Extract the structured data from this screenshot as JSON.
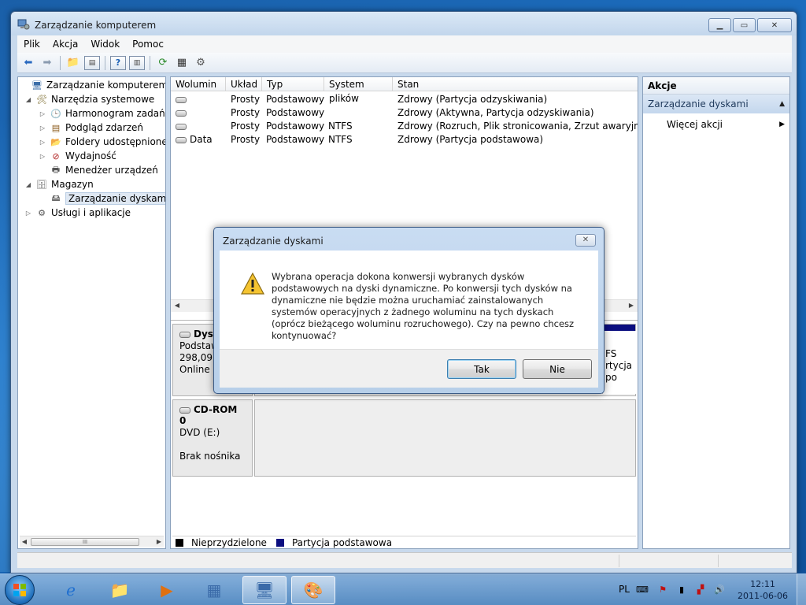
{
  "window": {
    "title": "Zarządzanie komputerem"
  },
  "menu": [
    "Plik",
    "Akcja",
    "Widok",
    "Pomoc"
  ],
  "tree": {
    "items": [
      {
        "label": "Zarządzanie komputerem (loka",
        "icon": "computer-icon",
        "level": 0,
        "expander": ""
      },
      {
        "label": "Narzędzia systemowe",
        "icon": "tools-icon",
        "level": 1,
        "expander": "◢"
      },
      {
        "label": "Harmonogram zadań",
        "icon": "clock-icon",
        "level": 2,
        "expander": "▷"
      },
      {
        "label": "Podgląd zdarzeń",
        "icon": "event-viewer-icon",
        "level": 2,
        "expander": "▷"
      },
      {
        "label": "Foldery udostępnione",
        "icon": "shared-folder-icon",
        "level": 2,
        "expander": "▷"
      },
      {
        "label": "Wydajność",
        "icon": "performance-icon",
        "level": 2,
        "expander": "▷"
      },
      {
        "label": "Menedżer urządzeń",
        "icon": "device-manager-icon",
        "level": 2,
        "expander": ""
      },
      {
        "label": "Magazyn",
        "icon": "storage-icon",
        "level": 1,
        "expander": "◢"
      },
      {
        "label": "Zarządzanie dyskami",
        "icon": "disk-management-icon",
        "level": 2,
        "expander": "",
        "selected": true
      },
      {
        "label": "Usługi i aplikacje",
        "icon": "services-icon",
        "level": 1,
        "expander": "▷"
      }
    ]
  },
  "volumes": {
    "columns": [
      "Wolumin",
      "Układ",
      "Typ",
      "System plików",
      "Stan"
    ],
    "rows": [
      {
        "name": "",
        "layout": "Prosty",
        "type": "Podstawowy",
        "fs": "",
        "status": "Zdrowy (Partycja odzyskiwania)"
      },
      {
        "name": "",
        "layout": "Prosty",
        "type": "Podstawowy",
        "fs": "",
        "status": "Zdrowy (Aktywna, Partycja odzyskiwania)"
      },
      {
        "name": "",
        "layout": "Prosty",
        "type": "Podstawowy",
        "fs": "NTFS",
        "status": "Zdrowy (Rozruch, Plik stronicowania, Zrzut awaryjny, Party"
      },
      {
        "name": "Data",
        "layout": "Prosty",
        "type": "Podstawowy",
        "fs": "NTFS",
        "status": "Zdrowy (Partycja podstawowa)"
      }
    ]
  },
  "disks": {
    "disk0": {
      "name": "Dysk",
      "type": "Podstaw",
      "size": "298,09 GI",
      "state": "Online",
      "part_fs": "FS",
      "part_status": "rtycja po"
    },
    "cdrom": {
      "name": "CD-ROM 0",
      "type": "DVD (E:)",
      "state": "Brak nośnika"
    }
  },
  "legend": [
    {
      "label": "Nieprzydzielone",
      "color": "#000000"
    },
    {
      "label": "Partycja podstawowa",
      "color": "#0b0e80"
    }
  ],
  "actions": {
    "title": "Akcje",
    "group": "Zarządzanie dyskami",
    "more": "Więcej akcji"
  },
  "dialog": {
    "title": "Zarządzanie dyskami",
    "message": "Wybrana operacja dokona konwersji wybranych dysków podstawowych na dyski dynamiczne. Po konwersji tych dysków na dynamiczne nie będzie można uruchamiać zainstalowanych systemów operacyjnych z żadnego woluminu na tych dyskach (oprócz bieżącego woluminu rozruchowego). Czy na pewno chcesz kontynuować?",
    "yes": "Tak",
    "no": "Nie"
  },
  "taskbar": {
    "language": "PL",
    "time": "12:11",
    "date": "2011-06-06"
  }
}
